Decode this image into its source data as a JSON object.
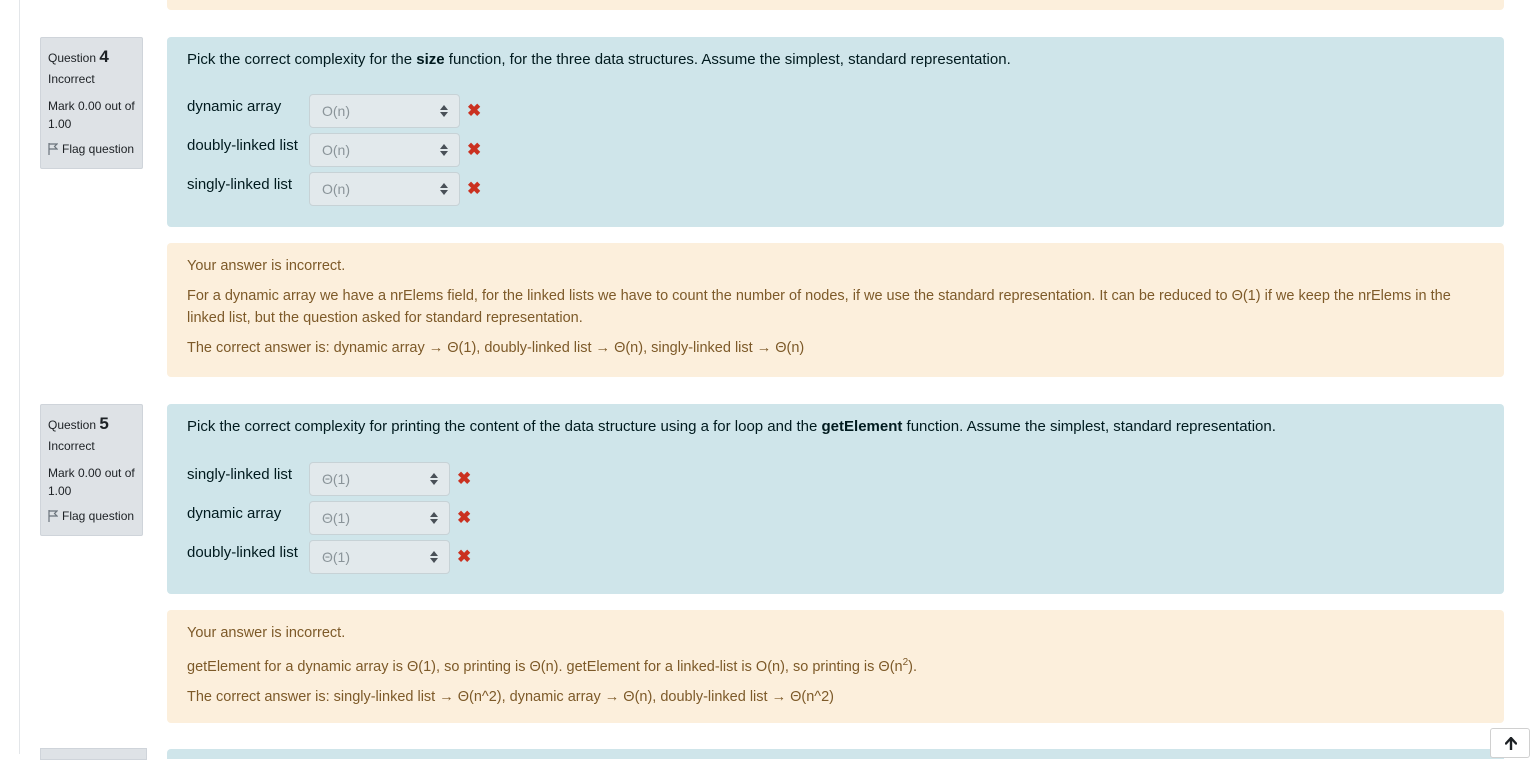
{
  "questions": [
    {
      "label": "Question",
      "number": "4",
      "state": "Incorrect",
      "grade": "Mark 0.00 out of 1.00",
      "flag_label": "Flag question",
      "text_before": "Pick the correct complexity for the ",
      "text_bold": "size",
      "text_after": " function, for the three data structures. Assume the simplest, standard representation.",
      "rows": [
        {
          "label": "dynamic array",
          "selected": "O(n)"
        },
        {
          "label": "doubly-linked list",
          "selected": "O(n)"
        },
        {
          "label": "singly-linked list",
          "selected": "O(n)"
        }
      ],
      "feedback": {
        "status": "Your answer is incorrect.",
        "general": "For a dynamic array we have a nrElems field, for the linked lists we have to count the number of nodes, if we use the standard representation. It can be reduced to Θ(1) if we keep the nrElems in the linked list, but the question asked for standard representation.",
        "right_answer": "The correct answer is: dynamic array → Θ(1), doubly-linked list → Θ(n), singly-linked list → Θ(n)"
      }
    },
    {
      "label": "Question",
      "number": "5",
      "state": "Incorrect",
      "grade": "Mark 0.00 out of 1.00",
      "flag_label": "Flag question",
      "text_before": "Pick the correct complexity for printing the content of the data structure using a for loop and the ",
      "text_bold": "getElement",
      "text_after": " function.  Assume the simplest, standard representation.",
      "rows": [
        {
          "label": "singly-linked list",
          "selected": "Θ(1)"
        },
        {
          "label": "dynamic array",
          "selected": "Θ(1)"
        },
        {
          "label": "doubly-linked list",
          "selected": "Θ(1)"
        }
      ],
      "feedback": {
        "status": "Your answer is incorrect.",
        "general_before": "getElement for a dynamic array is Θ(1), so printing is Θ(n). getElement for a linked-list is O(n), so printing is Θ(n",
        "general_sup": "2",
        "general_after": ").",
        "right_answer": "The correct answer is: singly-linked list → Θ(n^2), dynamic array → Θ(n), doubly-linked list → Θ(n^2)"
      }
    }
  ],
  "icons": {
    "flag": "flag-outline-icon",
    "incorrect": "x-mark-icon",
    "scroll_top": "arrow-up-icon"
  },
  "colors": {
    "formulation_bg": "#cfe5ea",
    "feedback_bg": "#fcefdc",
    "incorrect": "#ca3120",
    "feedback_text": "#7d5a29"
  }
}
